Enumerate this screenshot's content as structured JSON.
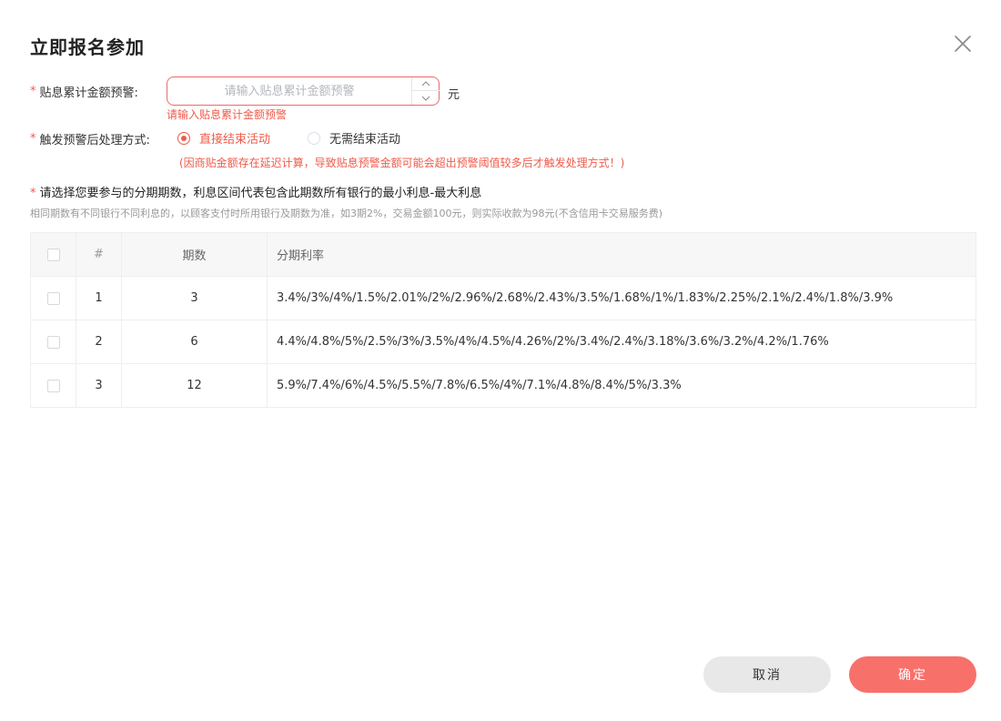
{
  "dialog": {
    "title": "立即报名参加"
  },
  "form": {
    "warn_amount": {
      "required_mark": "*",
      "label": "贴息累计金额预警:",
      "placeholder": "请输入贴息累计金额预警",
      "value": "",
      "unit": "元",
      "error": "请输入贴息累计金额预警"
    },
    "trigger": {
      "required_mark": "*",
      "label": "触发预警后处理方式:",
      "options": [
        {
          "label": "直接结束活动",
          "checked": true
        },
        {
          "label": "无需结束活动",
          "checked": false
        }
      ],
      "note": "(因商贴金额存在延迟计算，导致贴息预警金额可能会超出预警阈值较多后才触发处理方式！)"
    }
  },
  "installments": {
    "required_mark": "*",
    "title": "请选择您要参与的分期期数，利息区间代表包含此期数所有银行的最小利息-最大利息",
    "hint": "相同期数有不同银行不同利息的，以顾客支付时所用银行及期数为准，如3期2%，交易金额100元，则实际收款为98元(不含信用卡交易服务费)",
    "columns": {
      "index": "#",
      "periods": "期数",
      "rates": "分期利率"
    },
    "rows": [
      {
        "index": "1",
        "periods": "3",
        "rates": "3.4%/3%/4%/1.5%/2.01%/2%/2.96%/2.68%/2.43%/3.5%/1.68%/1%/1.83%/2.25%/2.1%/2.4%/1.8%/3.9%",
        "checked": false
      },
      {
        "index": "2",
        "periods": "6",
        "rates": "4.4%/4.8%/5%/2.5%/3%/3.5%/4%/4.5%/4.26%/2%/3.4%/2.4%/3.18%/3.6%/3.2%/4.2%/1.76%",
        "checked": false
      },
      {
        "index": "3",
        "periods": "12",
        "rates": "5.9%/7.4%/6%/4.5%/5.5%/7.8%/6.5%/4%/7.1%/4.8%/8.4%/5%/3.3%",
        "checked": false
      }
    ]
  },
  "footer": {
    "cancel_label": "取消",
    "ok_label": "确定"
  },
  "colors": {
    "accent": "#f05a4a",
    "ok_button": "#f8706a",
    "cancel_button": "#e8e8e8"
  },
  "icons": {
    "close": "close-icon",
    "stepper_up": "chevron-up-icon",
    "stepper_down": "chevron-down-icon"
  }
}
